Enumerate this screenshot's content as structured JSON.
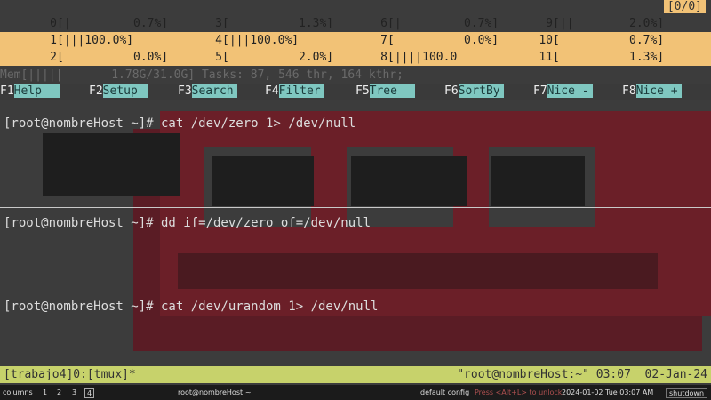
{
  "htop": {
    "cpus": [
      {
        "id": "0",
        "bar": "[|        ",
        "value": "0.7%]",
        "row": 0
      },
      {
        "id": "1",
        "bar": "[|||100.0%]",
        "value": "",
        "row": 1
      },
      {
        "id": "2",
        "bar": "[         ",
        "value": "0.0%]",
        "row": 2
      },
      {
        "id": "3",
        "bar": "[         ",
        "value": "1.3%]",
        "row": 0
      },
      {
        "id": "4",
        "bar": "[|||100.0%]",
        "value": "",
        "row": 1
      },
      {
        "id": "5",
        "bar": "[         ",
        "value": "2.0%]",
        "row": 2
      },
      {
        "id": "6",
        "bar": "[|        ",
        "value": "0.7%]",
        "row": 0
      },
      {
        "id": "7",
        "bar": "[         ",
        "value": "0.0%]",
        "row": 1
      },
      {
        "id": "8",
        "bar": "[||||100.0",
        "value": "",
        "row": 2
      },
      {
        "id": "9",
        "bar": "[||       ",
        "value": "2.0%]",
        "row": 0
      },
      {
        "id": "10",
        "bar": "[         ",
        "value": "0.7%]",
        "row": 1
      },
      {
        "id": "11",
        "bar": "[         ",
        "value": "1.3%]",
        "row": 2
      }
    ],
    "status_box": "[0/0]",
    "mem": "Mem[|||||       1.78G/31.0G] Tasks: 87, 546 thr, 164 kthr;"
  },
  "fkeys": [
    {
      "num": "F1",
      "label": "Help  "
    },
    {
      "num": "F2",
      "label": "Setup "
    },
    {
      "num": "F3",
      "label": "Search"
    },
    {
      "num": "F4",
      "label": "Filter"
    },
    {
      "num": "F5",
      "label": "Tree  "
    },
    {
      "num": "F6",
      "label": "SortBy"
    },
    {
      "num": "F7",
      "label": "Nice -"
    },
    {
      "num": "F8",
      "label": "Nice +"
    }
  ],
  "panes": [
    {
      "prompt": "[root@nombreHost ~]# cat /dev/zero 1> /dev/null"
    },
    {
      "prompt": "[root@nombreHost ~]# dd if=/dev/zero of=/dev/null"
    },
    {
      "prompt": "[root@nombreHost ~]# cat /dev/urandom 1> /dev/null"
    }
  ],
  "tmux": {
    "left": "[trabajo4]0:[tmux]*",
    "right": "\"root@nombreHost:~\" 03:07  02-Jan-24"
  },
  "taskbar": {
    "columns_label": "columns",
    "workspaces": [
      "1",
      "2",
      "3",
      "4"
    ],
    "active_workspace": "4",
    "window_title": "root@nombreHost:~",
    "config": "default config",
    "warning": "Press <Alt+L> to unlock",
    "datetime": "2024-01-02 Tue 03:07 AM",
    "shutdown": "shutdown"
  },
  "colors": {
    "htop_highlight": "#f2c276",
    "fkey_label_bg": "#7fc7c0",
    "tmux_status_bg": "#c7d26b",
    "logo_red": "#6b1f28"
  }
}
